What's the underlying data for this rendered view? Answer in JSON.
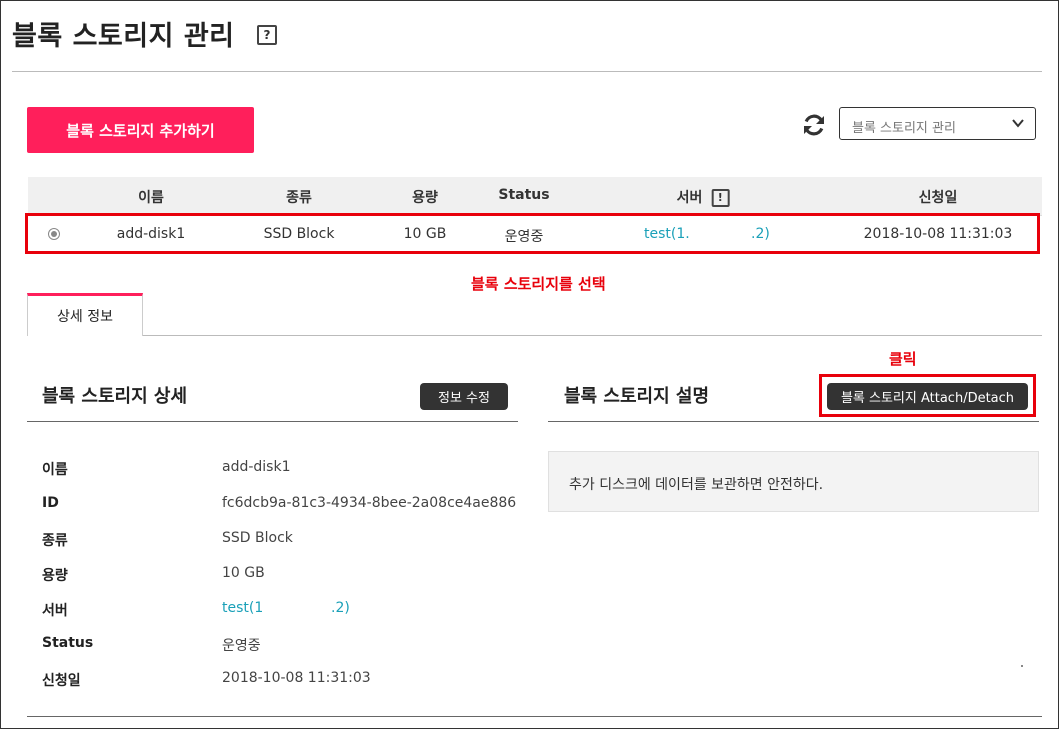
{
  "header": {
    "title": "블록 스토리지 관리",
    "help_label": "?"
  },
  "toolbar": {
    "add_button": "블록 스토리지 추가하기",
    "select_value": "블록 스토리지 관리"
  },
  "table": {
    "columns": [
      "이름",
      "종류",
      "용량",
      "Status",
      "서버",
      "신청일"
    ],
    "server_info_label": "!",
    "rows": [
      {
        "name": "add-disk1",
        "type": "SSD Block",
        "capacity": "10 GB",
        "status": "운영중",
        "server_prefix": "test(1.",
        "server_suffix": ".2)",
        "date": "2018-10-08 11:31:03"
      }
    ]
  },
  "annotations": {
    "select_hint": "블록 스토리지를 선택",
    "click_hint": "클릭",
    "highlight_color": "#e8000b"
  },
  "tabs": [
    {
      "label": "상세 정보",
      "active": true
    }
  ],
  "detail": {
    "title": "블록 스토리지 상세",
    "edit_button": "정보 수정",
    "fields": [
      {
        "label": "이름",
        "value": "add-disk1"
      },
      {
        "label": "ID",
        "value": "fc6dcb9a-81c3-4934-8bee-2a08ce4ae886"
      },
      {
        "label": "종류",
        "value": "SSD Block"
      },
      {
        "label": "용량",
        "value": "10 GB"
      },
      {
        "label": "서버",
        "value_prefix": "test(1",
        "value_suffix": ".2)"
      },
      {
        "label": "Status",
        "value": "운영중"
      },
      {
        "label": "신청일",
        "value": "2018-10-08 11:31:03"
      }
    ]
  },
  "description": {
    "title": "블록 스토리지 설명",
    "attach_button": "블록 스토리지 Attach/Detach",
    "text": "추가 디스크에 데이터를 보관하면 안전하다."
  },
  "colors": {
    "accent": "#ff1f5b",
    "link": "#1aa0b8",
    "dark_button": "#333333"
  }
}
